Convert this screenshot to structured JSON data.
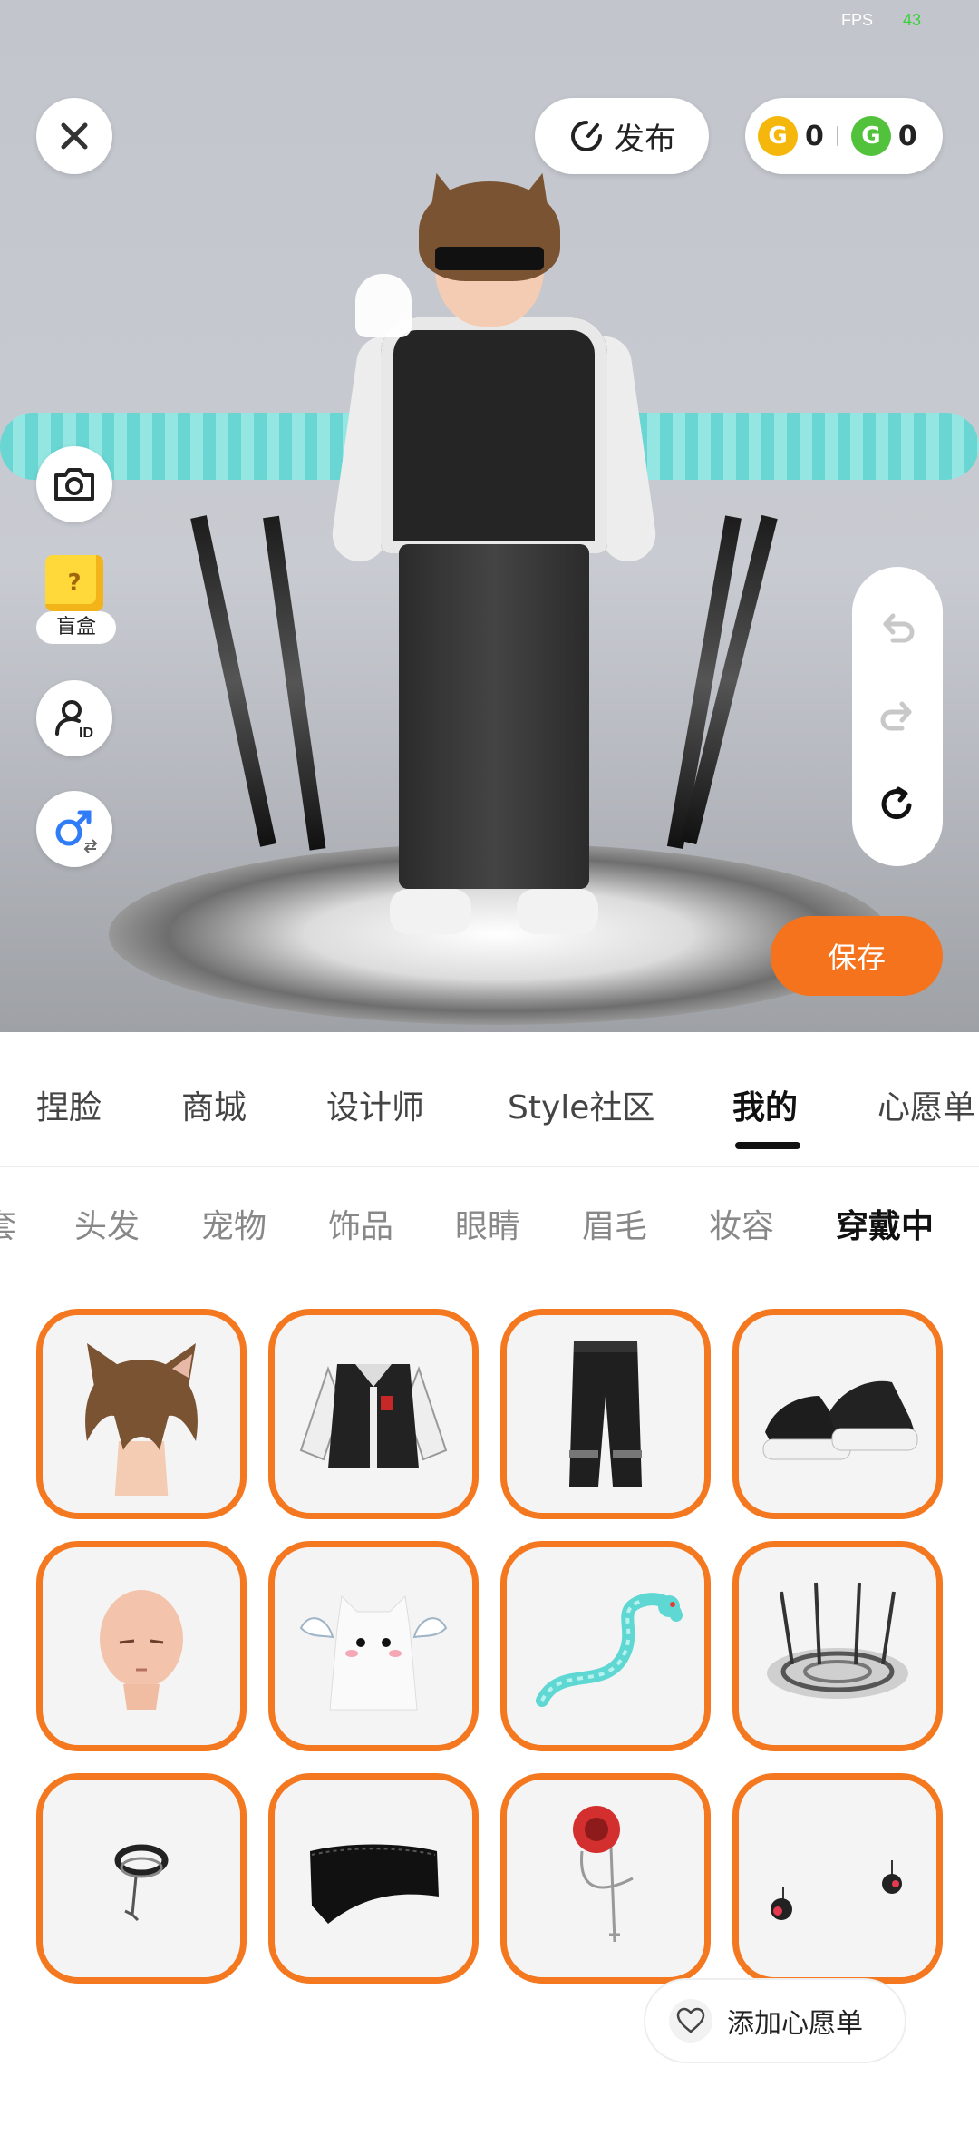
{
  "status": {
    "fps_label": "FPS",
    "fps_value": "43"
  },
  "topbar": {
    "close_icon": "close-icon",
    "publish_label": "发布",
    "coins": [
      {
        "icon": "gold-coin-icon",
        "value": "0"
      },
      {
        "icon": "green-coin-icon",
        "value": "0"
      }
    ]
  },
  "side_tools": {
    "camera_icon": "camera-icon",
    "blindbox_label": "盲盒",
    "blindbox_glyph": "?",
    "avatar_id_icon": "user-id-icon",
    "gender_icon": "male-gender-switch-icon"
  },
  "history": {
    "undo_icon": "undo-icon",
    "redo_icon": "redo-icon",
    "reset_icon": "reset-icon"
  },
  "save_label": "保存",
  "main_tabs": [
    {
      "label": "捏脸"
    },
    {
      "label": "商城"
    },
    {
      "label": "设计师"
    },
    {
      "label": "Style社区"
    },
    {
      "label": "我的",
      "active": true
    },
    {
      "label": "心愿单"
    }
  ],
  "sub_tabs": [
    {
      "label": "套"
    },
    {
      "label": "头发"
    },
    {
      "label": "宠物"
    },
    {
      "label": "饰品"
    },
    {
      "label": "眼睛"
    },
    {
      "label": "眉毛"
    },
    {
      "label": "妆容"
    },
    {
      "label": "穿戴中",
      "active": true
    }
  ],
  "items": [
    "cat-ear-hair",
    "varsity-jacket",
    "black-pants",
    "platform-sneakers",
    "face-base",
    "ghost-cat-pet",
    "cyan-dragon",
    "sword-circle-platform",
    "choker-necklace",
    "black-blindfold",
    "red-rose-chain",
    "earrings"
  ],
  "wishlist_label": "添加心愿单",
  "accent_color": "#f4781f"
}
